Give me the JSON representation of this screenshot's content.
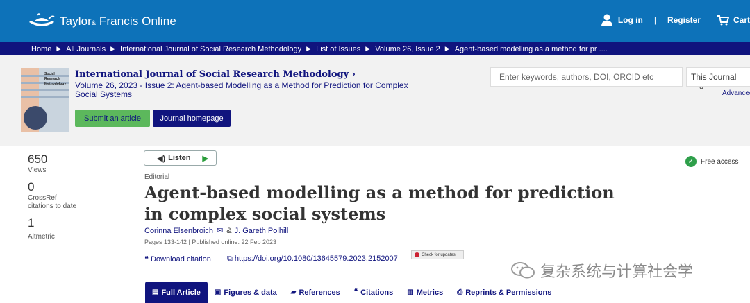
{
  "header": {
    "brand": "Taylor",
    "brand_amp": "&",
    "brand_rest": "Francis Online",
    "login": "Log in",
    "separator": "|",
    "register": "Register",
    "cart": "Cart"
  },
  "breadcrumb": [
    "Home",
    "All Journals",
    "International Journal of Social Research Methodology",
    "List of Issues",
    "Volume 26, Issue 2",
    "Agent-based modelling as a method for pr ...."
  ],
  "journal": {
    "name": "International Journal of Social Research Methodology",
    "issue": "Volume 26, 2023 - Issue 2: Agent-based Modelling as a Method for Prediction for Complex Social Systems",
    "cover_title": "Social Research Methodology",
    "submit_label": "Submit an article",
    "homepage_label": "Journal homepage"
  },
  "search": {
    "placeholder": "Enter keywords, authors, DOI, ORCID etc",
    "scope": "This Journal",
    "advanced": "Advanced"
  },
  "metrics": [
    {
      "value": "650",
      "label": "Views"
    },
    {
      "value": "0",
      "label": "CrossRef citations to date"
    },
    {
      "value": "1",
      "label": "Altmetric"
    }
  ],
  "article": {
    "listen_label": "Listen",
    "access": "Free access",
    "type": "Editorial",
    "title": "Agent-based modelling as a method for prediction in complex social systems",
    "author1": "Corinna Elsenbroich",
    "author_amp": "&",
    "author2": "J. Gareth Polhill",
    "meta": "Pages 133-142 | Published online: 22 Feb 2023",
    "download_citation": "Download citation",
    "doi": "https://doi.org/10.1080/13645579.2023.2152007",
    "check_updates": "Check for updates"
  },
  "watermark": "复杂系统与计算社会学",
  "tabs": [
    {
      "label": "Full Article",
      "icon": "document-icon"
    },
    {
      "label": "Figures & data",
      "icon": "image-icon"
    },
    {
      "label": "References",
      "icon": "book-icon"
    },
    {
      "label": "Citations",
      "icon": "quote-icon"
    },
    {
      "label": "Metrics",
      "icon": "bar-chart-icon"
    },
    {
      "label": "Reprints & Permissions",
      "icon": "print-icon"
    }
  ],
  "colors": {
    "brand_blue": "#0d72b9",
    "navy": "#10147e",
    "green": "#5cb85c"
  }
}
